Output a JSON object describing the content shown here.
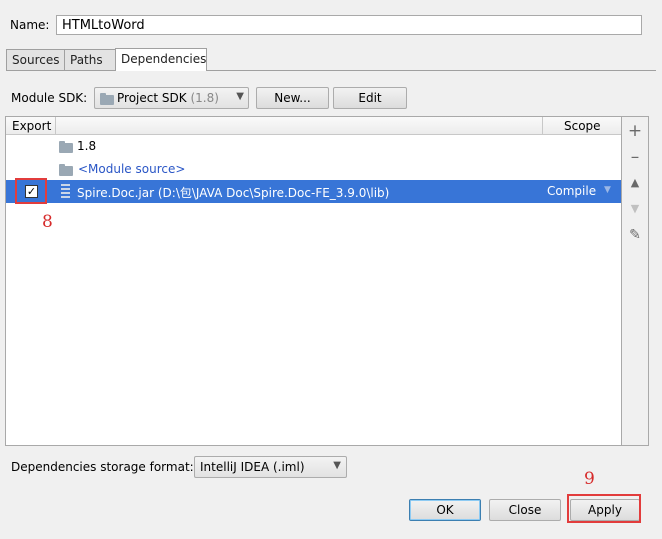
{
  "name": {
    "label": "Name:",
    "value": "HTMLtoWord"
  },
  "tabs": [
    {
      "label": "Sources"
    },
    {
      "label": "Paths"
    },
    {
      "label": "Dependencies"
    }
  ],
  "sdk": {
    "label": "Module SDK:",
    "selected_name": "Project SDK",
    "selected_version": "(1.8)",
    "new_label": "New...",
    "edit_label": "Edit"
  },
  "table": {
    "col_export": "Export",
    "col_scope": "Scope",
    "rows": [
      {
        "text": "1.8"
      },
      {
        "text": "<Module source>"
      },
      {
        "text": "Spire.Doc.jar (D:\\包\\JAVA Doc\\Spire.Doc-FE_3.9.0\\lib)",
        "scope": "Compile",
        "checked": "✓"
      }
    ]
  },
  "annotations": {
    "first": "8",
    "second": "9"
  },
  "storage": {
    "label": "Dependencies storage format:",
    "value": "IntelliJ IDEA (.iml)"
  },
  "buttons": {
    "ok": "OK",
    "close": "Close",
    "apply": "Apply"
  },
  "colors": {
    "selection": "#3875d7",
    "annotation": "#e23c3c",
    "link": "#2a56c6"
  }
}
